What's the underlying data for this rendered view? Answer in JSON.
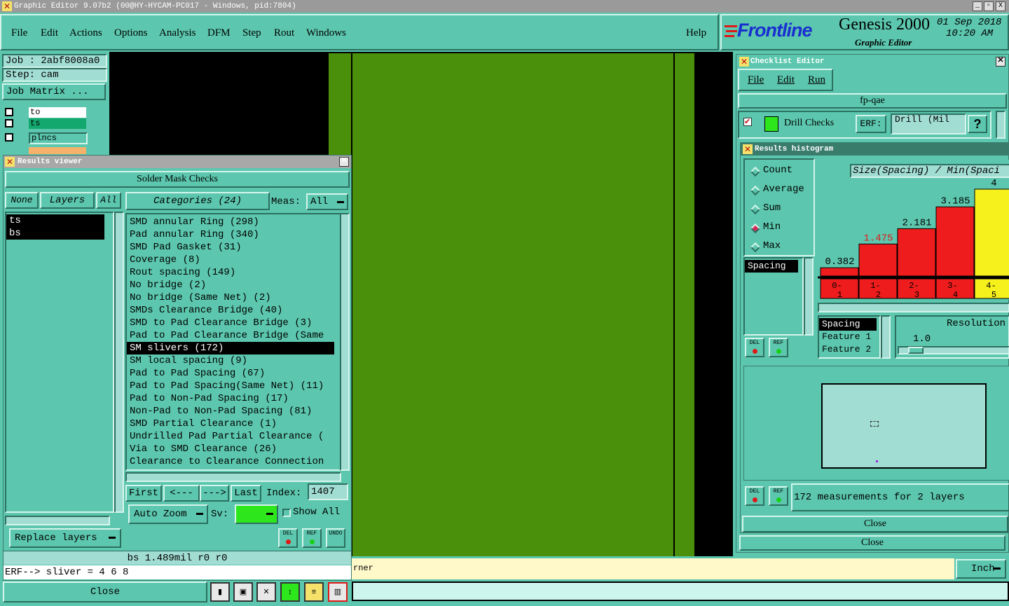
{
  "window": {
    "title": "Graphic Editor 9.07b2 (00@HY-HYCAM-PC017 - Windows, pid:7804)",
    "minimize": "_",
    "maximize": "▫",
    "close": "X"
  },
  "menubar": {
    "items": [
      "File",
      "Edit",
      "Actions",
      "Options",
      "Analysis",
      "DFM",
      "Step",
      "Rout",
      "Windows"
    ],
    "help": "Help"
  },
  "brand": {
    "logo": "Frontline",
    "product": "Genesis 2000",
    "subtitle": "Graphic Editor",
    "date": "01 Sep 2018",
    "time": "10:20 AM",
    "logo_color": "#1a2fd0",
    "stripe_color": "#e01818"
  },
  "job_panel": {
    "job": "Job : 2abf8008a0",
    "step": "Step: cam",
    "job_matrix": "Job Matrix ...",
    "layers": [
      {
        "name": "to",
        "color": "#ffffff"
      },
      {
        "name": "ts",
        "color": "#13a86e"
      },
      {
        "name": "plncs",
        "color": "#5cc7ae"
      }
    ]
  },
  "canvas": {
    "colors": {
      "board": "#4a900a",
      "background": "#000000"
    }
  },
  "results_viewer": {
    "title": "Results viewer",
    "header": "Solder Mask Checks",
    "none_btn": "None",
    "layers_btn": "Layers",
    "all_btn": "All",
    "layers": [
      "ts",
      "bs"
    ],
    "categories_btn": "Categories (24)",
    "meas_label": "Meas:",
    "meas_value": "All",
    "categories": [
      "SMD annular Ring (298)",
      "Pad annular Ring (340)",
      "SMD Pad Gasket (31)",
      "Coverage (8)",
      "Rout spacing (149)",
      "No bridge (2)",
      "No bridge (Same Net) (2)",
      "SMDs Clearance Bridge (40)",
      "SMD to Pad Clearance Bridge (3)",
      "Pad to Pad Clearance Bridge (Same",
      "SM slivers (172)",
      "SM local spacing (9)",
      "Pad to Pad Spacing (67)",
      "Pad to Pad Spacing(Same Net) (11)",
      "Pad to Non-Pad Spacing (17)",
      "Non-Pad to Non-Pad Spacing (81)",
      "SMD Partial Clearance (1)",
      "Undrilled Pad Partial Clearance (",
      "Via to SMD Clearance (26)",
      "Clearance to Clearance Connection"
    ],
    "selected_category": "SM slivers (172)",
    "nav": {
      "first": "First",
      "prev": "<---",
      "next": "--->",
      "last": "Last",
      "index_label": "Index:",
      "index_value": "1407"
    },
    "auto_zoom": "Auto Zoom",
    "sv_label": "Sv:",
    "show_all": "Show All",
    "replace_layers": "Replace layers",
    "del": "DEL",
    "ref": "REF",
    "undo": "UNDO",
    "status": "bs 1.489mil  r0  r0",
    "erf": "ERF--> sliver = 4 6 8",
    "close": "Close"
  },
  "bottom_bar": {
    "prompt_tail": "rner",
    "units": "Inch"
  },
  "checklist_editor": {
    "title": "Checklist Editor",
    "menu": [
      "File",
      "Edit",
      "Run"
    ],
    "checklist_name": "fp-qae",
    "action_name": "Drill Checks",
    "erf_label": "ERF:",
    "erf_value": "Drill (Mil",
    "help": "?",
    "close": "Close"
  },
  "results_histogram": {
    "title": "Results histogram",
    "modes": [
      "Count",
      "Average",
      "Sum",
      "Min",
      "Max"
    ],
    "selected_mode": "Min",
    "measurement_list": [
      "Spacing"
    ],
    "sort_list": [
      "Spacing",
      "Feature 1",
      "Feature 2"
    ],
    "resolution_label": "Resolution",
    "resolution_value": "1.0",
    "resolution_slider": 0.1,
    "summary": "172 measurements for 2 layers",
    "close": "Close",
    "del": "DEL",
    "ref": "REF"
  },
  "chart_data": {
    "type": "bar",
    "title": "Size(Spacing) / Min(Spaci",
    "categories": [
      "0-1",
      "1-2",
      "2-3",
      "3-4",
      "4-5"
    ],
    "values": [
      0.382,
      1.475,
      2.181,
      3.185,
      4
    ],
    "value_labels": [
      "0.382",
      "1.475",
      "2.181",
      "3.185",
      "4"
    ],
    "bar_colors": [
      "#ee1c1c",
      "#ee1c1c",
      "#ee1c1c",
      "#ee1c1c",
      "#f6f01c"
    ],
    "highlight_label_index": 1,
    "highlight_label_color": "#e01818",
    "ylim": [
      0,
      4
    ]
  }
}
